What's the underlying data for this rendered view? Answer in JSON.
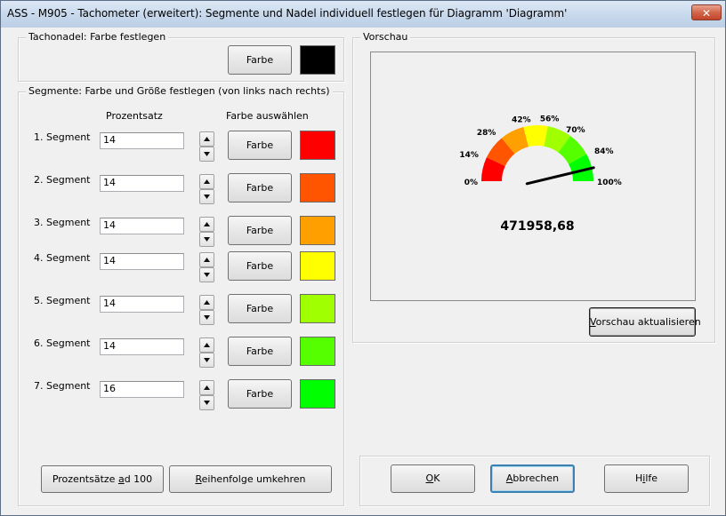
{
  "window": {
    "title": "ASS - M905 - Tachometer (erweitert): Segmente und Nadel individuell festlegen für Diagramm 'Diagramm'",
    "close_label": "✕"
  },
  "needle": {
    "group_label": "Tachonadel: Farbe festlegen",
    "button_label": "Farbe",
    "color": "#000000"
  },
  "segments_group": {
    "label": "Segmente: Farbe und Größe festlegen (von links nach rechts)",
    "col_percent": "Prozentsatz",
    "col_color": "Farbe auswählen",
    "button_label": "Farbe",
    "items": [
      {
        "label": "1. Segment",
        "value": "14",
        "color": "#ff0000"
      },
      {
        "label": "2. Segment",
        "value": "14",
        "color": "#ff5500"
      },
      {
        "label": "3. Segment",
        "value": "14",
        "color": "#ffa000"
      },
      {
        "label": "4. Segment",
        "value": "14",
        "color": "#ffff00"
      },
      {
        "label": "5. Segment",
        "value": "14",
        "color": "#a0ff00"
      },
      {
        "label": "6. Segment",
        "value": "14",
        "color": "#55ff00"
      },
      {
        "label": "7. Segment",
        "value": "16",
        "color": "#00ff00"
      }
    ],
    "btn_percent_pre": "Prozentsätze ",
    "btn_percent_accel": "a",
    "btn_percent_post": "d 100",
    "btn_reverse_accel": "R",
    "btn_reverse_post": "eihenfolge umkehren"
  },
  "preview": {
    "group_label": "Vorschau",
    "gauge_value": "471958,68",
    "needle_fraction": 0.925,
    "tick_labels": [
      "0%",
      "14%",
      "28%",
      "42%",
      "56%",
      "70%",
      "84%",
      "100%"
    ],
    "tick_fractions": [
      0,
      0.14,
      0.28,
      0.42,
      0.56,
      0.7,
      0.84,
      1.0
    ],
    "update_accel": "V",
    "update_post": "orschau aktualisieren"
  },
  "footer": {
    "ok_accel": "O",
    "ok_post": "K",
    "cancel_accel": "A",
    "cancel_post": "bbrechen",
    "help_pre": "H",
    "help_accel": "i",
    "help_post": "lfe"
  }
}
